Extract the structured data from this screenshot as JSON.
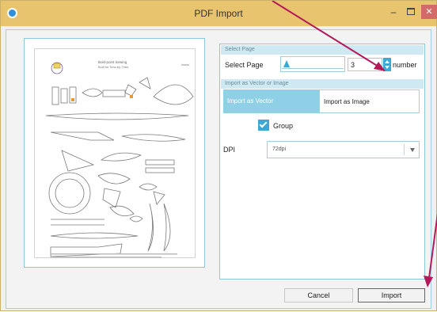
{
  "window": {
    "title": "PDF Import",
    "minimize_glyph": "–",
    "close_glyph": "✕"
  },
  "select_page_section": {
    "header": "Select Page",
    "label": "Select Page",
    "page_value": "3",
    "annotation_text": "number"
  },
  "import_mode_section": {
    "header": "Import as Vector or Image",
    "vector_label": "Import as Vector",
    "image_label": "Import as Image",
    "selected": "Import as Vector"
  },
  "group": {
    "label": "Group",
    "checked": true
  },
  "dpi": {
    "label": "DPI",
    "value": "72dpi"
  },
  "buttons": {
    "cancel": "Cancel",
    "import": "Import"
  },
  "colors": {
    "titlebar": "#e9c46f",
    "accent": "#3ba8d6",
    "selected_mode": "#8fd0e6",
    "annotation_arrow": "#b5195a"
  },
  "preview": {
    "heading": "Bold-point Sewing",
    "subheading": "Built for Sew-by-Thee"
  }
}
